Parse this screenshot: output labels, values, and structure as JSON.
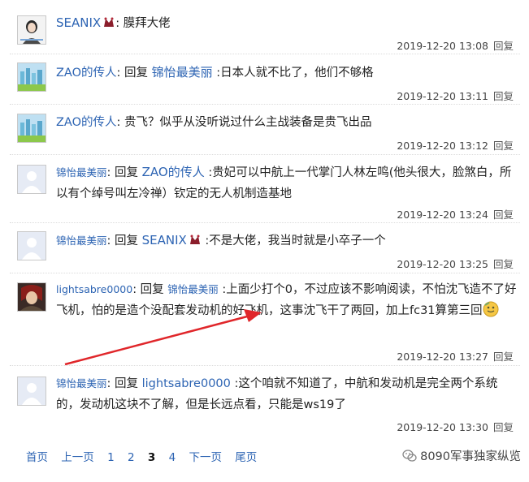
{
  "comments": [
    {
      "user": "SEANIX",
      "text": ": 膜拜大佬",
      "time": "2019-12-20 13:08",
      "reply": "回复"
    },
    {
      "user": "ZAO的传人",
      "reply_prefix": ": 回复",
      "target": "锦怡最美丽",
      "text": " :日本人就不比了，他们不够格",
      "time": "2019-12-20 13:11",
      "reply": "回复"
    },
    {
      "user": "ZAO的传人",
      "text": ": 贵飞？似乎从没听说过什么主战装备是贵飞出品",
      "time": "2019-12-20 13:12",
      "reply": "回复"
    },
    {
      "user": "锦怡最美丽",
      "reply_prefix": ": 回复",
      "target": "ZAO的传人",
      "text": " :贵妃可以中航上一代掌门人林左鸣(他头很大，脸煞白，所以有个绰号叫左冷禅）钦定的无人机制造基地",
      "time": "2019-12-20 13:24",
      "reply": "回复"
    },
    {
      "user": "锦怡最美丽",
      "reply_prefix": ": 回复",
      "target": "SEANIX",
      "text": " :不是大佬，我当时就是小卒子一个",
      "time": "2019-12-20 13:25",
      "reply": "回复"
    },
    {
      "user": "lightsabre0000",
      "reply_prefix": ": 回复",
      "target": "锦怡最美丽",
      "text": " :上面少打个0，不过应该不影响阅读，不怕沈飞造不了好飞机，怕的是造个没配套发动机的好飞机，这事沈飞干了两回，加上fc31算第三回",
      "time": "2019-12-20 13:27",
      "reply": "回复"
    },
    {
      "user": "锦怡最美丽",
      "reply_prefix": ": 回复",
      "target": "lightsabre0000",
      "text": " :这个咱就不知道了，中航和发动机是完全两个系统的，发动机这块不了解，但是长远点看，只能是ws19了",
      "time": "2019-12-20 13:30",
      "reply": "回复"
    }
  ],
  "pager": {
    "first": "首页",
    "prev": "上一页",
    "p1": "1",
    "p2": "2",
    "p3": "3",
    "p4": "4",
    "next": "下一页",
    "last": "尾页"
  },
  "watermark": "8090军事独家纵览",
  "colors": {
    "link": "#2d64b3",
    "arrow": "#e0262a"
  }
}
